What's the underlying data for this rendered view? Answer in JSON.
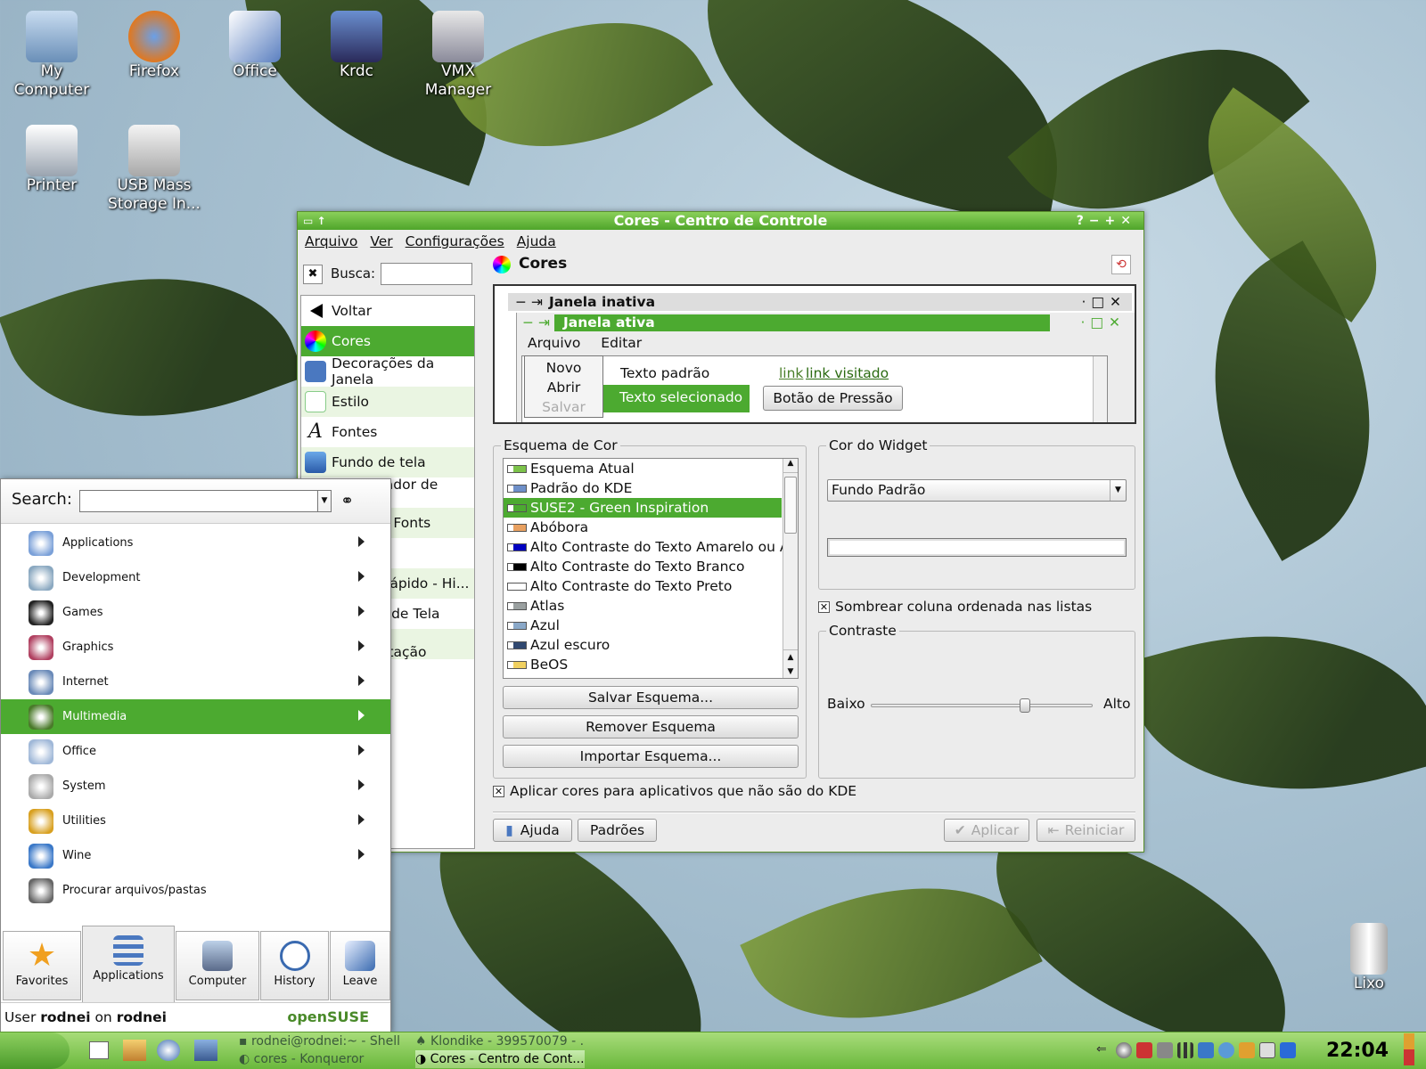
{
  "desktop": {
    "icons": [
      {
        "label": "My\nComputer",
        "icon": "my-computer-icon"
      },
      {
        "label": "Firefox",
        "icon": "firefox-icon"
      },
      {
        "label": "Office",
        "icon": "office-icon"
      },
      {
        "label": "Krdc",
        "icon": "krdc-icon"
      },
      {
        "label": "VMX\nManager",
        "icon": "vmx-manager-icon"
      },
      {
        "label": "Printer",
        "icon": "printer-icon"
      },
      {
        "label": "USB Mass\nStorage In...",
        "icon": "usb-storage-icon"
      },
      {
        "label": "Lixo",
        "icon": "trash-icon"
      }
    ]
  },
  "window": {
    "title": "Cores - Centro de Controle",
    "menu": [
      "Arquivo",
      "Ver",
      "Configurações",
      "Ajuda"
    ],
    "search_label": "Busca:",
    "search_value": "",
    "sidebar": [
      "Voltar",
      "Cores",
      "Decorações da Janela",
      "Estilo",
      "Fontes",
      "Fundo de tela",
      "Gerenciador de Tem...",
      "Ícones e Fonts",
      "",
      "Acesso rápido - Hi...",
      "Protetor de Tela",
      "Modo de Apresentação"
    ],
    "page_title": "Cores",
    "preview": {
      "inactive": "Janela inativa",
      "active": "Janela ativa",
      "menu": [
        "Arquivo",
        "Editar"
      ],
      "popup": [
        "Novo",
        "Abrir",
        "Salvar"
      ],
      "normal_text": "Texto padrão",
      "selected_text": "Texto selecionado",
      "link": "link",
      "visited": "link visitado",
      "push_button": "Botão de Pressão"
    },
    "scheme": {
      "title": "Esquema de Cor",
      "items": [
        {
          "name": "Esquema Atual",
          "swatch": "#7cc24a"
        },
        {
          "name": "Padrão do KDE",
          "swatch": "#6e8fc8"
        },
        {
          "name": "SUSE2 - Green Inspiration",
          "swatch": "#4caa30"
        },
        {
          "name": "Abóbora",
          "swatch": "#e8a060"
        },
        {
          "name": "Alto Contraste do Texto Amarelo ou Azul",
          "swatch": "#0000c0"
        },
        {
          "name": "Alto Contraste do Texto Branco",
          "swatch": "#000000"
        },
        {
          "name": "Alto Contraste do Texto Preto",
          "swatch": "#ffffff"
        },
        {
          "name": "Atlas",
          "swatch": "#9aa0a0"
        },
        {
          "name": "Azul",
          "swatch": "#8aa8c8"
        },
        {
          "name": "Azul escuro",
          "swatch": "#304870"
        },
        {
          "name": "BeOS",
          "swatch": "#f0d060"
        }
      ],
      "save": "Salvar Esquema...",
      "remove": "Remover Esquema",
      "import": "Importar Esquema..."
    },
    "widget": {
      "title": "Cor do Widget",
      "selected": "Fundo Padrão"
    },
    "shade_label": "Sombrear coluna ordenada nas listas",
    "contrast": {
      "title": "Contraste",
      "low": "Baixo",
      "high": "Alto",
      "value": 0.7
    },
    "apply_nonkde": "Aplicar cores para aplicativos que não são do KDE",
    "buttons": {
      "help": "Ajuda",
      "defaults": "Padrões",
      "apply": "Aplicar",
      "reset": "Reiniciar"
    }
  },
  "kmenu": {
    "search_label": "Search:",
    "items": [
      "Applications",
      "Development",
      "Games",
      "Graphics",
      "Internet",
      "Multimedia",
      "Office",
      "System",
      "Utilities",
      "Wine",
      "Procurar arquivos/pastas"
    ],
    "tabs": [
      "Favorites",
      "Applications",
      "Computer",
      "History",
      "Leave"
    ],
    "footer_user": "User ",
    "user": "rodnei",
    "on": " on ",
    "host": "rodnei",
    "brand": "openSUSE"
  },
  "taskbar": {
    "tasks": [
      "rodnei@rodnei:~ - Shell",
      "Klondike - 399570079 - ...",
      "cores - Konqueror",
      "Cores - Centro de Cont..."
    ],
    "clock": "22:04"
  },
  "colors": {
    "accent": "#4caa30",
    "titlebar": "#6bbd3f"
  }
}
